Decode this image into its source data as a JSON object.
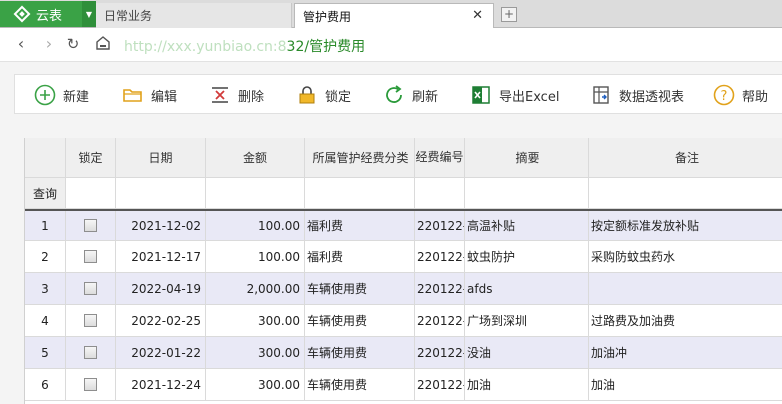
{
  "app": {
    "name": "云表"
  },
  "tabs": [
    {
      "label": "日常业务",
      "active": false
    },
    {
      "label": "管护费用",
      "active": true
    }
  ],
  "address": {
    "url_hidden": "http://xxx.yunbiao.cn:8",
    "url_visible": "32/管护费用"
  },
  "toolbar": {
    "new": "新建",
    "edit": "编辑",
    "delete": "删除",
    "lock": "锁定",
    "refresh": "刷新",
    "export": "导出Excel",
    "pivot": "数据透视表",
    "help": "帮助"
  },
  "grid": {
    "columns": [
      "锁定",
      "日期",
      "金额",
      "所属管护经费分类",
      "经费编号",
      "摘要",
      "备注"
    ],
    "filter_label": "查询",
    "rows": [
      {
        "idx": "1",
        "date": "2021-12-02",
        "amount": "100.00",
        "category": "福利费",
        "no": "220122-",
        "summary": "高温补贴",
        "note": "按定额标准发放补贴"
      },
      {
        "idx": "2",
        "date": "2021-12-17",
        "amount": "100.00",
        "category": "福利费",
        "no": "220122-",
        "summary": "蚊虫防护",
        "note": "采购防蚊虫药水"
      },
      {
        "idx": "3",
        "date": "2022-04-19",
        "amount": "2,000.00",
        "category": "车辆使用费",
        "no": "220122-",
        "summary": "afds",
        "note": ""
      },
      {
        "idx": "4",
        "date": "2022-02-25",
        "amount": "300.00",
        "category": "车辆使用费",
        "no": "220122-",
        "summary": "广场到深圳",
        "note": "过路费及加油费"
      },
      {
        "idx": "5",
        "date": "2022-01-22",
        "amount": "300.00",
        "category": "车辆使用费",
        "no": "220122-",
        "summary": "没油",
        "note": "加油冲"
      },
      {
        "idx": "6",
        "date": "2021-12-24",
        "amount": "300.00",
        "category": "车辆使用费",
        "no": "220122-",
        "summary": "加油",
        "note": "加油"
      }
    ]
  },
  "colors": {
    "brand": "#3aa246",
    "row_alt": "#e9e9f6",
    "url": "#2a8a2a"
  }
}
